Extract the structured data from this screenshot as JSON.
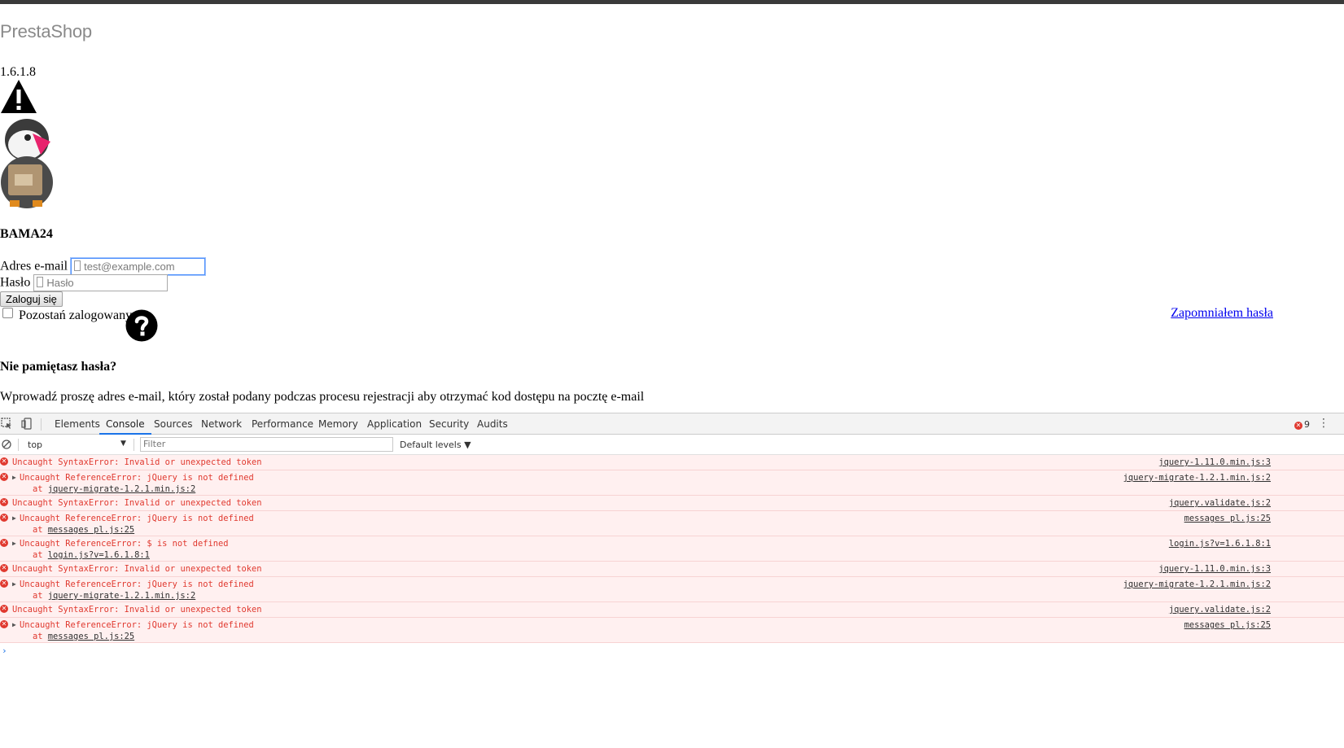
{
  "page": {
    "logo": "PrestaShop",
    "version": "1.6.1.8",
    "shop_name": "BAMA24",
    "login": {
      "email_label": "Adres e-mail",
      "email_placeholder": "test@example.com",
      "password_label": "Hasło",
      "password_placeholder": "Hasło",
      "submit_label": "Zaloguj się",
      "remember_label": "Pozostań zalogowany",
      "forgot_link": "Zapomniałem hasła"
    },
    "forgot": {
      "title": "Nie pamiętasz hasła?",
      "description": "Wprowadź proszę adres e-mail, który został podany podczas procesu rejestracji aby otrzymać kod dostępu na pocztę e-mail"
    }
  },
  "devtools": {
    "tabs": [
      "Elements",
      "Console",
      "Sources",
      "Network",
      "Performance",
      "Memory",
      "Application",
      "Security",
      "Audits"
    ],
    "active_tab": "Console",
    "error_count": "9",
    "context": "top",
    "filter_placeholder": "Filter",
    "levels": "Default levels",
    "messages": [
      {
        "text": "Uncaught SyntaxError: Invalid or unexpected token",
        "at": "",
        "src": "jquery-1.11.0.min.js:3"
      },
      {
        "text": "Uncaught ReferenceError: jQuery is not defined",
        "at": "jquery-migrate-1.2.1.min.js:2",
        "src": "jquery-migrate-1.2.1.min.js:2"
      },
      {
        "text": "Uncaught SyntaxError: Invalid or unexpected token",
        "at": "",
        "src": "jquery.validate.js:2"
      },
      {
        "text": "Uncaught ReferenceError: jQuery is not defined",
        "at": "messages pl.js:25",
        "src": "messages pl.js:25"
      },
      {
        "text": "Uncaught ReferenceError: $ is not defined",
        "at": "login.js?v=1.6.1.8:1",
        "src": "login.js?v=1.6.1.8:1"
      },
      {
        "text": "Uncaught SyntaxError: Invalid or unexpected token",
        "at": "",
        "src": "jquery-1.11.0.min.js:3"
      },
      {
        "text": "Uncaught ReferenceError: jQuery is not defined",
        "at": "jquery-migrate-1.2.1.min.js:2",
        "src": "jquery-migrate-1.2.1.min.js:2"
      },
      {
        "text": "Uncaught SyntaxError: Invalid or unexpected token",
        "at": "",
        "src": "jquery.validate.js:2"
      },
      {
        "text": "Uncaught ReferenceError: jQuery is not defined",
        "at": "messages pl.js:25",
        "src": "messages pl.js:25"
      }
    ],
    "at_prefix": "at",
    "colors": {
      "error": "#e0392f",
      "error_bg": "#fff0f0",
      "accent": "#1a73e8"
    }
  }
}
